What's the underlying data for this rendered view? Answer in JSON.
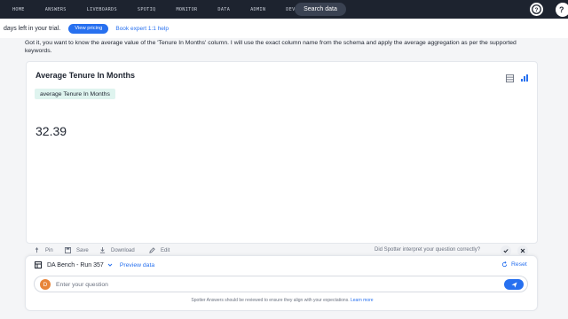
{
  "nav": {
    "items": [
      {
        "label": "HOME"
      },
      {
        "label": "ANSWERS"
      },
      {
        "label": "LIVEBOARDS"
      },
      {
        "label": "SPOTIQ"
      },
      {
        "label": "MONITOR"
      },
      {
        "label": "DATA"
      },
      {
        "label": "ADMIN"
      },
      {
        "label": "DEVELOP"
      }
    ],
    "search_label": "Search data",
    "help_icon": "question-circle-icon",
    "avatar_letter": "?"
  },
  "trial": {
    "text": "days left in your trial.",
    "pricing_label": "View pricing",
    "expert_label": "Book expert 1:1 help"
  },
  "assistant": {
    "message": "Got it, you want to know the average value of the 'Tenure In Months' column. I will use the exact column name from the schema and apply the average aggregation as per the supported keywords."
  },
  "answer": {
    "title": "Average Tenure In Months",
    "token": "average Tenure In Months",
    "value": "32.39"
  },
  "actions": {
    "pin": "Pin",
    "save": "Save",
    "download": "Download",
    "edit": "Edit",
    "feedback_question": "Did Spotter interpret your question correctly?"
  },
  "composer": {
    "source_name": "DA Bench - Run 357",
    "preview_label": "Preview data",
    "reset_label": "Reset",
    "user_initial": "D",
    "placeholder": "Enter your question",
    "disclaimer": "Spotter Answers should be reviewed to ensure they align with your expectations.",
    "learn_more": "Learn more"
  },
  "colors": {
    "nav_bg": "#1d232f",
    "accent": "#2770ef",
    "token_bg": "#dff4ef",
    "user_avatar": "#e8853a"
  }
}
